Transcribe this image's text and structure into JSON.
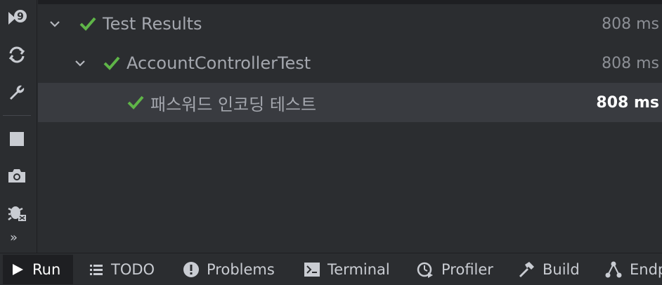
{
  "tree": {
    "rows": [
      {
        "label": "Test Results",
        "time": "808 ms",
        "status": "passed"
      },
      {
        "label": "AccountControllerTest",
        "time": "808 ms",
        "status": "passed"
      },
      {
        "label": "패스워드 인코딩 테스트",
        "time": "808 ms",
        "status": "passed"
      }
    ]
  },
  "sidebar": {
    "icons": [
      "rerun-failed-icon",
      "toggle-auto-test-icon",
      "wrench-icon",
      "stop-icon",
      "camera-icon",
      "debug-icon"
    ],
    "more_label": "»"
  },
  "toolwindows": [
    {
      "label": "Run",
      "icon": "play-icon",
      "active": true
    },
    {
      "label": "TODO",
      "icon": "list-icon",
      "active": false
    },
    {
      "label": "Problems",
      "icon": "problems-icon",
      "active": false
    },
    {
      "label": "Terminal",
      "icon": "terminal-icon",
      "active": false
    },
    {
      "label": "Profiler",
      "icon": "profiler-icon",
      "active": false
    },
    {
      "label": "Build",
      "icon": "hammer-icon",
      "active": false
    },
    {
      "label": "Endp",
      "icon": "endpoints-icon",
      "active": false
    }
  ],
  "colors": {
    "pass": "#5fb548",
    "background": "#2b2d30",
    "selection": "#393b40"
  }
}
